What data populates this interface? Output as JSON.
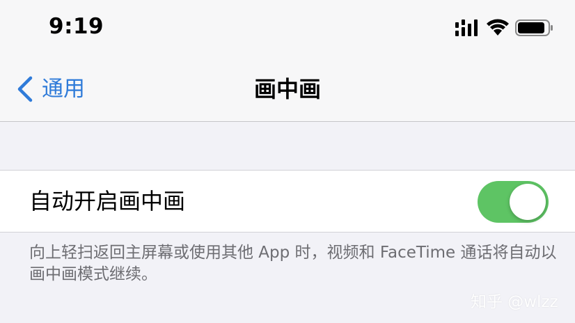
{
  "status_bar": {
    "time": "9:19",
    "icons": [
      "cellular-signal-icon",
      "wifi-icon",
      "battery-icon"
    ]
  },
  "nav": {
    "back_label": "通用",
    "title": "画中画"
  },
  "setting": {
    "label": "自动开启画中画",
    "toggle_on": true,
    "toggle_color": "#5ec464"
  },
  "footer": {
    "note": "向上轻扫返回主屏幕或使用其他 App 时，视频和 FaceTime 通话将自动以画中画模式继续。"
  },
  "watermark": "知乎 @wlzz",
  "colors": {
    "accent": "#2f7bd9",
    "background": "#f2f2f7"
  }
}
